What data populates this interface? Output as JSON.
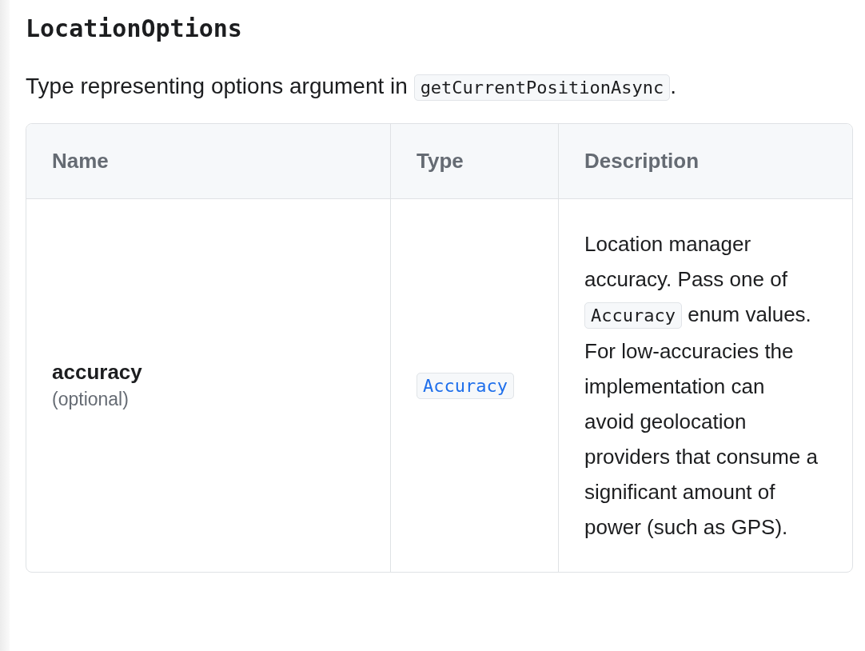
{
  "heading": "LocationOptions",
  "intro": [
    {
      "kind": "text",
      "text": "Type representing options argument in "
    },
    {
      "kind": "code",
      "text": "getCurrentPositionAsync"
    },
    {
      "kind": "text",
      "text": "."
    }
  ],
  "table": {
    "columns": [
      "Name",
      "Type",
      "Description"
    ],
    "rows": [
      {
        "name": "accuracy",
        "note": "(optional)",
        "type": "Accuracy",
        "description": [
          {
            "kind": "text",
            "text": "Location manager accuracy. Pass one of "
          },
          {
            "kind": "code",
            "text": "Accuracy"
          },
          {
            "kind": "text",
            "text": " enum values. For low-accuracies the implementation can avoid geolocation providers that consume a significant amount of power (such as GPS)."
          }
        ]
      }
    ]
  }
}
